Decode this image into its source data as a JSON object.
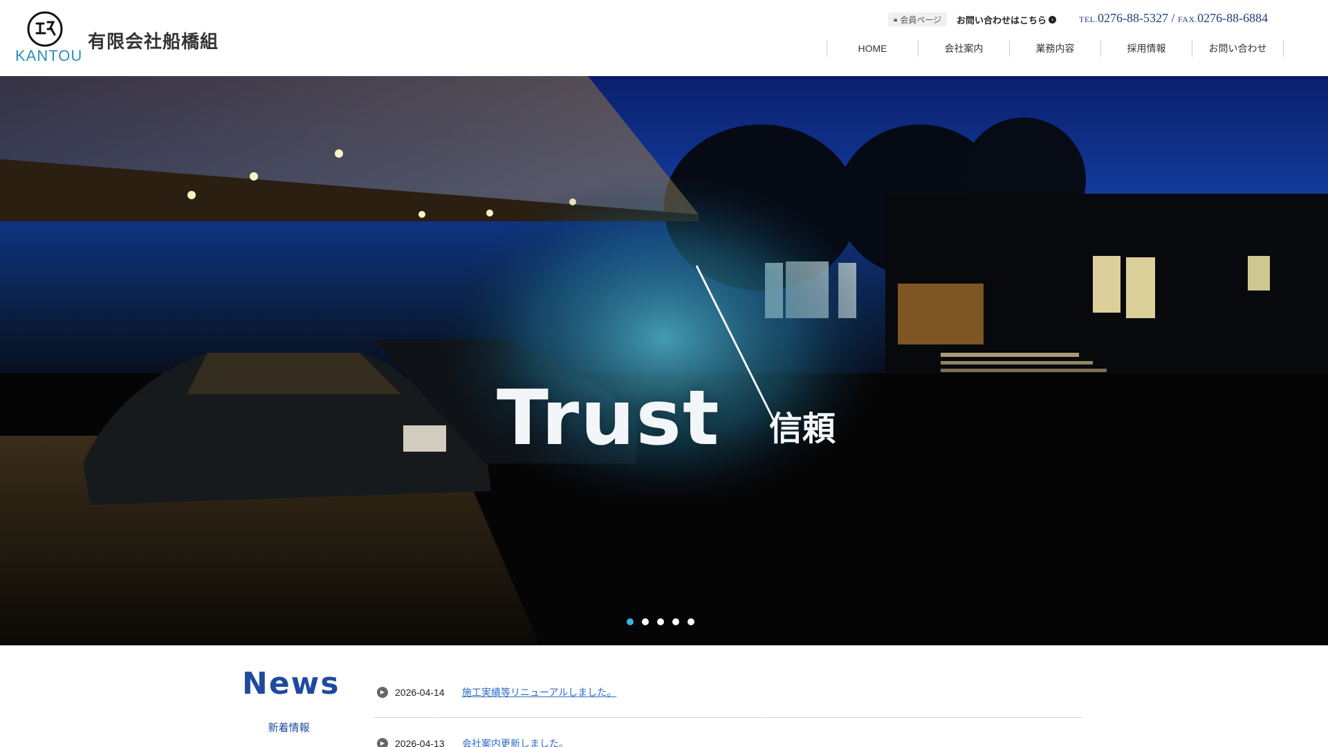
{
  "header": {
    "logo_text": "KANTOU",
    "company_name": "有限会社船橋組",
    "member_link": "会員ページ",
    "contact_link": "お問い合わせはこちら",
    "tel_label": "TEL.",
    "tel": "0276-88-5327",
    "separator": " / ",
    "fax_label": "FAX.",
    "fax": "0276-88-6884"
  },
  "nav": {
    "items": [
      {
        "label": "HOME"
      },
      {
        "label": "会社案内"
      },
      {
        "label": "業務内容"
      },
      {
        "label": "採用情報"
      },
      {
        "label": "お問い合わせ"
      }
    ]
  },
  "hero": {
    "slogan": "Trust",
    "slogan_jp": "信頼",
    "slide_count": 5,
    "active_slide": 1
  },
  "news": {
    "title": "News",
    "subtitle": "新着情報",
    "items": [
      {
        "date": "2026-04-14",
        "title": "施工実績等リニューアルしました。"
      },
      {
        "date": "2026-04-13",
        "title": "会社案内更新しました。"
      }
    ]
  },
  "colors": {
    "accent": "#1f4aa0",
    "link": "#2a6bc4",
    "active_dot": "#3fb0e0"
  }
}
